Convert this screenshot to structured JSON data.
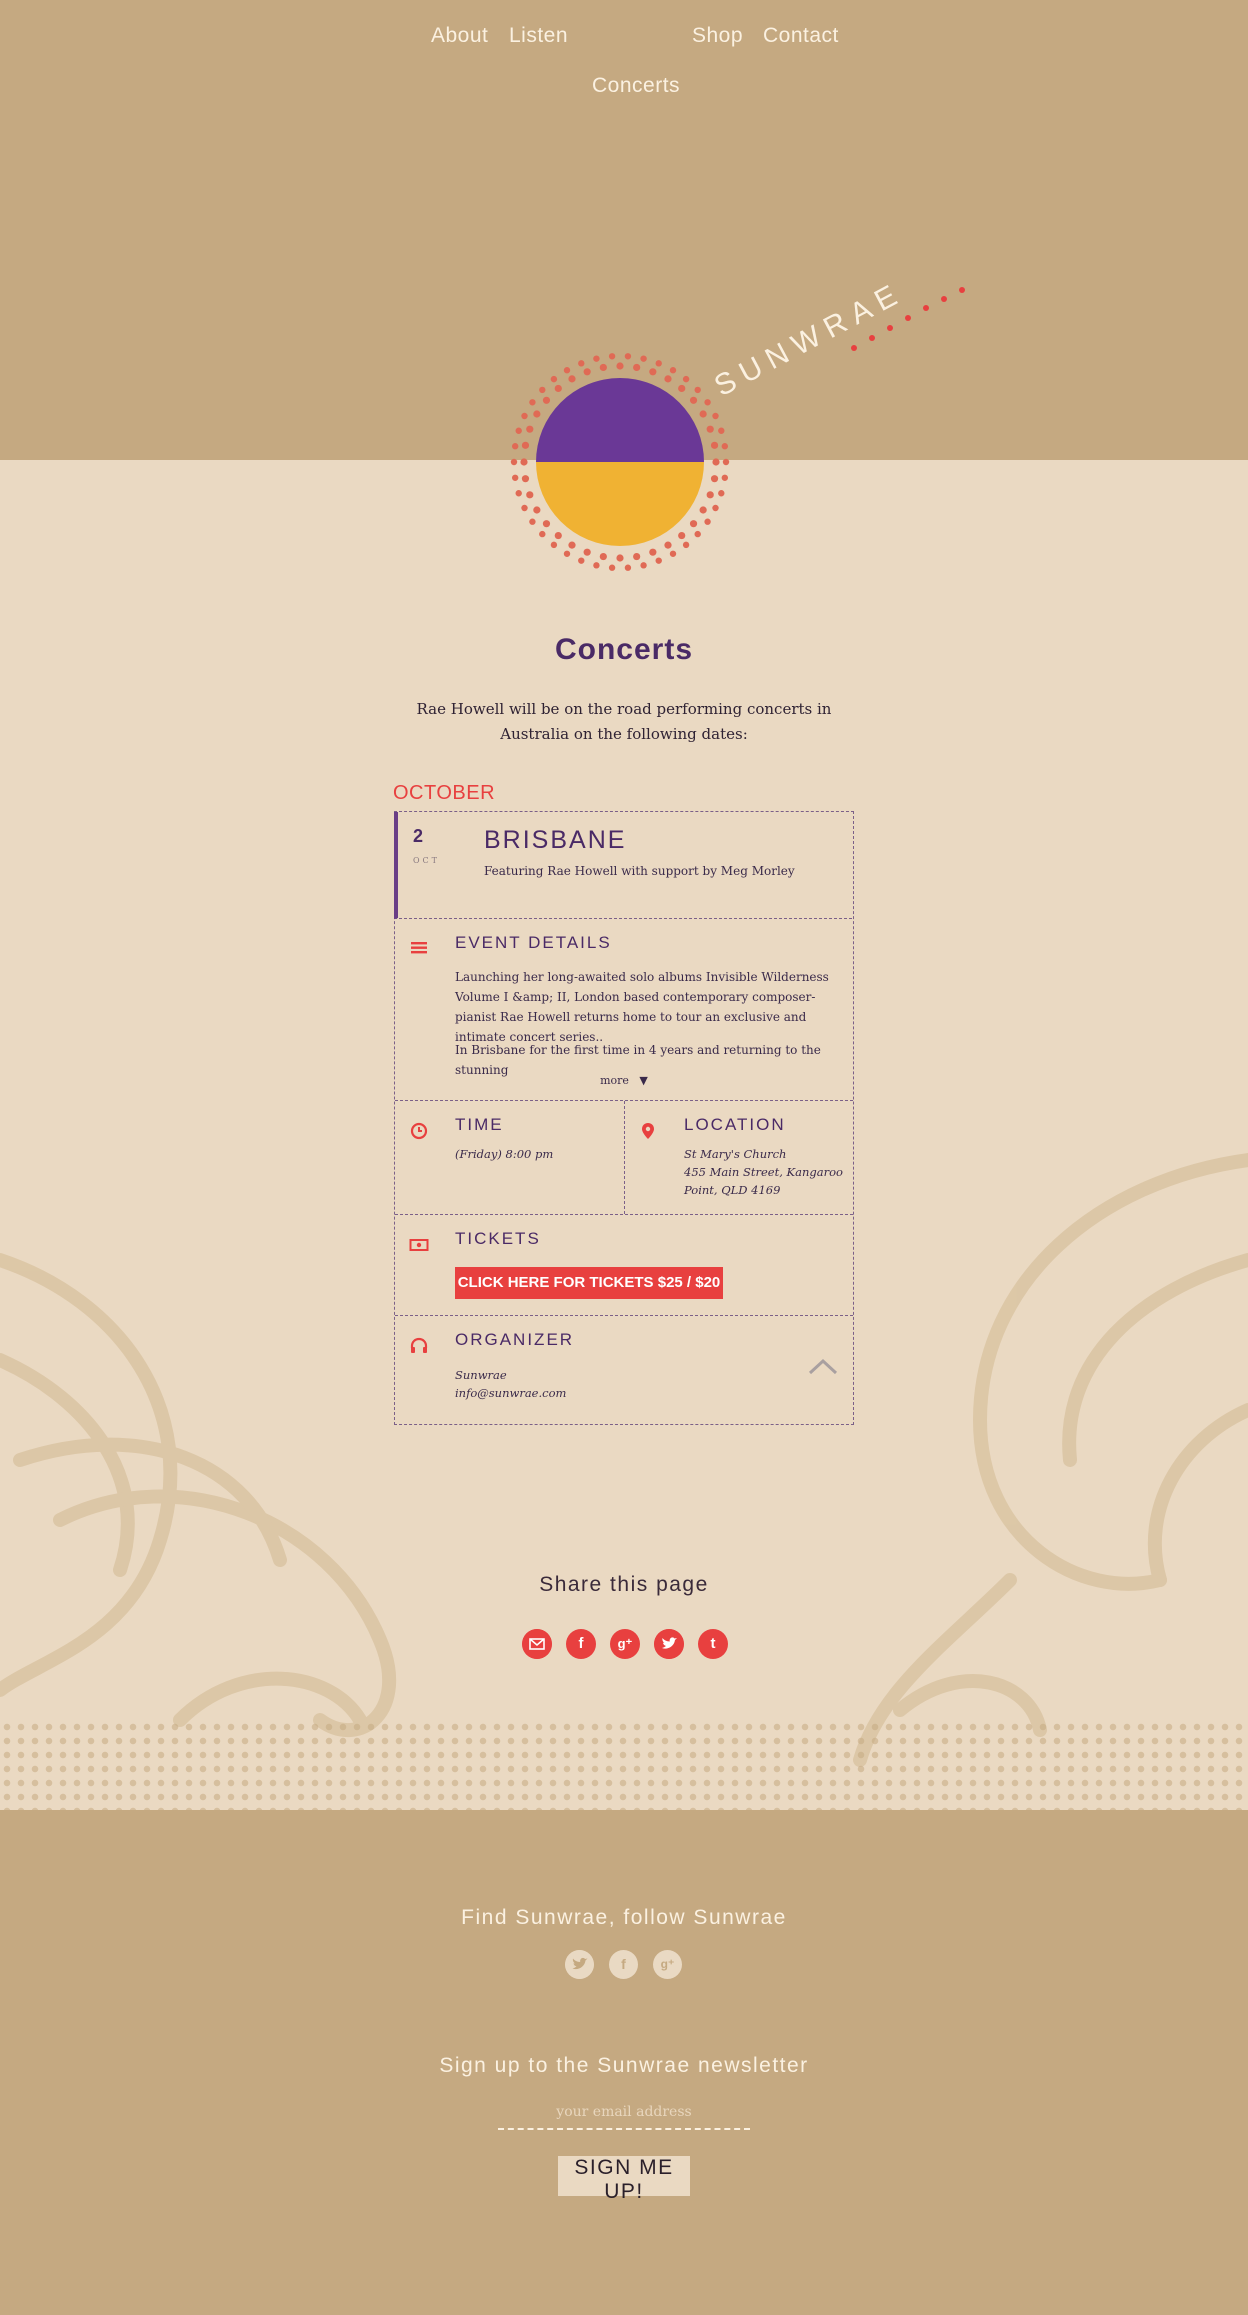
{
  "nav": {
    "about": "About",
    "listen": "Listen",
    "shop": "Shop",
    "contact": "Contact",
    "concerts": "Concerts"
  },
  "brand": {
    "name": "SUNWRAE"
  },
  "page": {
    "title": "Concerts",
    "intro": "Rae Howell will be on the road performing concerts in Australia on the following dates:"
  },
  "event": {
    "month": "OCTOBER",
    "day": "2",
    "month_short": "OCT",
    "city": "BRISBANE",
    "featuring": "Featuring Rae Howell with support by Meg Morley",
    "details_heading": "EVENT DETAILS",
    "details_p1": "Launching her long-awaited solo albums Invisible Wilderness Volume I &amp; II, London based contemporary composer-pianist Rae Howell returns home to tour an exclusive and intimate concert series..",
    "details_p2": "In Brisbane for the first time in 4 years and returning to the stunning",
    "more": "more",
    "time_heading": "TIME",
    "time": "(Friday) 8:00 pm",
    "location_heading": "LOCATION",
    "venue": "St Mary's Church",
    "address1": "455 Main Street, Kangaroo",
    "address2": "Point, QLD 4169",
    "tickets_heading": "TICKETS",
    "tickets_button": "CLICK HERE FOR TICKETS $25 / $20",
    "organizer_heading": "ORGANIZER",
    "organizer_name": "Sunwrae",
    "organizer_email": "info@sunwrae.com"
  },
  "share": {
    "title": "Share this page"
  },
  "footer": {
    "find_title": "Find Sunwrae, follow Sunwrae",
    "newsletter_title": "Sign up to the Sunwrae newsletter",
    "email_placeholder": "your email address",
    "signup_button": "SIGN ME UP!"
  },
  "colors": {
    "accent": "#e8403f",
    "purple": "#6a3e86",
    "gold": "#f0b233",
    "tan": "#c5a981",
    "cream": "#ead9c2"
  }
}
